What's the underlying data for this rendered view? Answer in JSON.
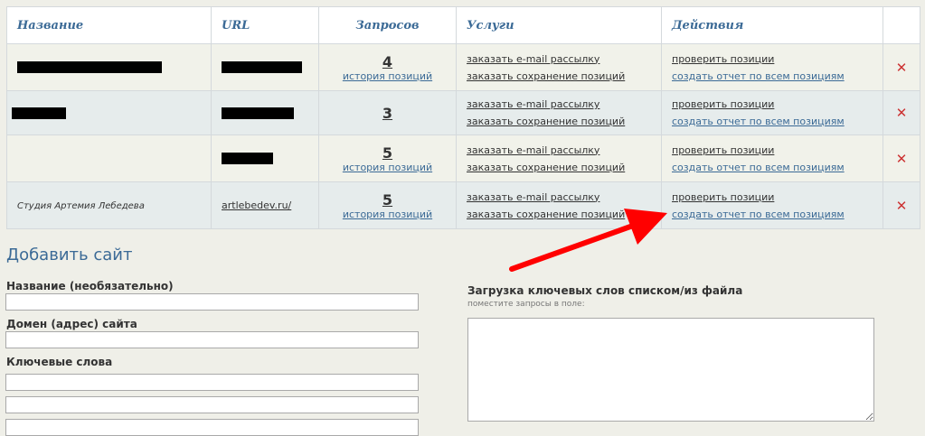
{
  "table": {
    "headers": {
      "name": "Название",
      "url": "URL",
      "requests": "Запросов",
      "services": "Услуги",
      "actions": "Действия"
    },
    "rows": [
      {
        "name": "",
        "url": "",
        "count": "4",
        "history": "история позиций",
        "service_email": "заказать e-mail рассылку",
        "service_save": "заказать сохранение позиций",
        "action_check": "проверить позиции",
        "action_report": "создать отчет по всем позициям",
        "delete": "✕"
      },
      {
        "name": "",
        "url": "",
        "count": "3",
        "history": "",
        "service_email": "заказать e-mail рассылку",
        "service_save": "заказать сохранение позиций",
        "action_check": "проверить позиции",
        "action_report": "создать отчет по всем позициям",
        "delete": "✕"
      },
      {
        "name": "",
        "url": "",
        "count": "5",
        "history": "история позиций",
        "service_email": "заказать e-mail рассылку",
        "service_save": "заказать сохранение позиций",
        "action_check": "проверить позиции",
        "action_report": "создать отчет по всем позициям",
        "delete": "✕"
      },
      {
        "name": "Студия Артемия Лебедева",
        "url": "artlebedev.ru/",
        "count": "5",
        "history": "история позиций",
        "service_email": "заказать e-mail рассылку",
        "service_save": "заказать сохранение позиций",
        "action_check": "проверить позиции",
        "action_report": "создать отчет по всем позициям",
        "delete": "✕"
      }
    ]
  },
  "form": {
    "title": "Добавить сайт",
    "name_label": "Название (необязательно)",
    "name_value": "",
    "domain_label": "Домен (адрес) сайта",
    "domain_value": "",
    "keywords_label": "Ключевые слова",
    "keyword1_value": "",
    "keyword2_value": "",
    "keyword3_value": ""
  },
  "upload": {
    "title": "Загрузка ключевых слов списком/из файла",
    "hint": "поместите запросы в поле:",
    "value": ""
  },
  "colors": {
    "accent": "#3b6a96",
    "delete": "#cc3333",
    "annotation_arrow": "#ff0000"
  }
}
